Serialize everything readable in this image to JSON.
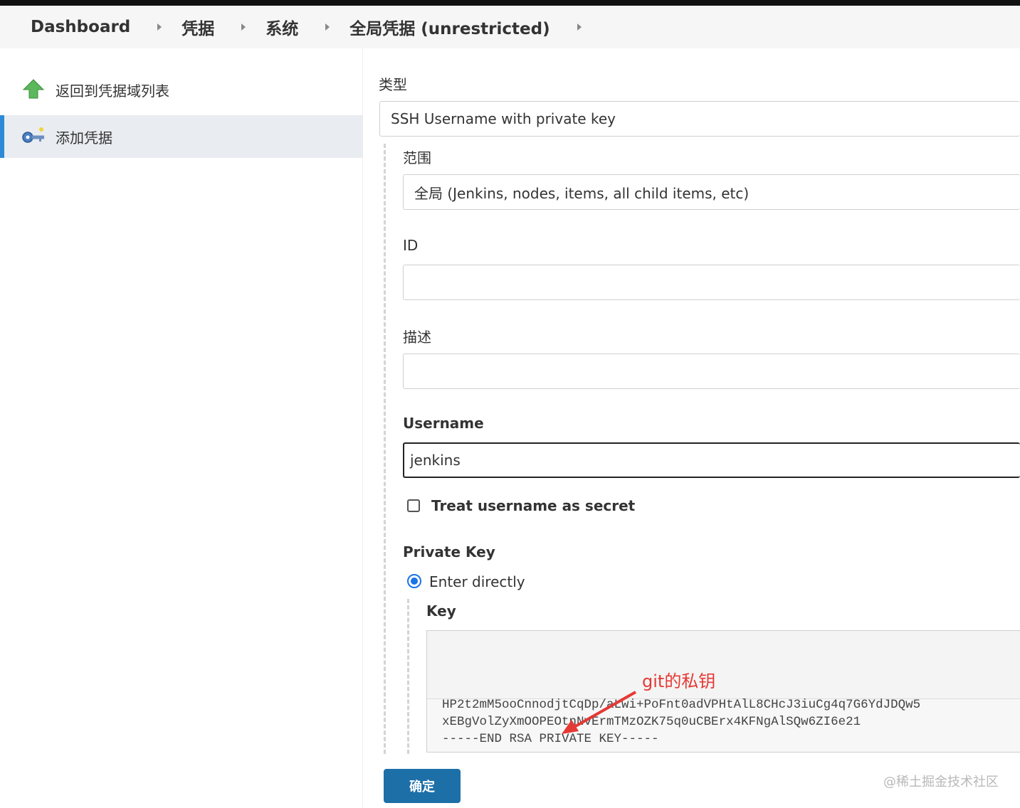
{
  "breadcrumb": {
    "items": [
      "Dashboard",
      "凭据",
      "系统",
      "全局凭据 (unrestricted)"
    ]
  },
  "sidebar": {
    "items": [
      {
        "label": "返回到凭据域列表",
        "icon": "green-up-arrow-icon"
      },
      {
        "label": "添加凭据",
        "icon": "key-icon"
      }
    ]
  },
  "form": {
    "type_label": "类型",
    "type_value": "SSH Username with private key",
    "scope_label": "范围",
    "scope_value": "全局 (Jenkins, nodes, items, all child items, etc)",
    "id_label": "ID",
    "id_value": "",
    "description_label": "描述",
    "description_value": "",
    "username_label": "Username",
    "username_value": "jenkins",
    "treat_secret_label": "Treat username as secret",
    "private_key_label": "Private Key",
    "enter_directly_label": "Enter directly",
    "key_label": "Key",
    "key_lines": [
      "HP2t2mM5ooCnnodjtCqDp/aLwi+PoFnt0adVPHtAlL8CHcJ3iuCg4q7G6YdJDQw5",
      "xEBgVolZyXmOOPEOtnNvErmTMzOZK75q0uCBErx4KFNgAlSQw6ZI6e21",
      "-----END RSA PRIVATE KEY-----"
    ],
    "submit_label": "确定"
  },
  "annotation": {
    "text": "git的私钥",
    "color": "#e53935"
  },
  "watermark": "@稀土掘金技术社区"
}
